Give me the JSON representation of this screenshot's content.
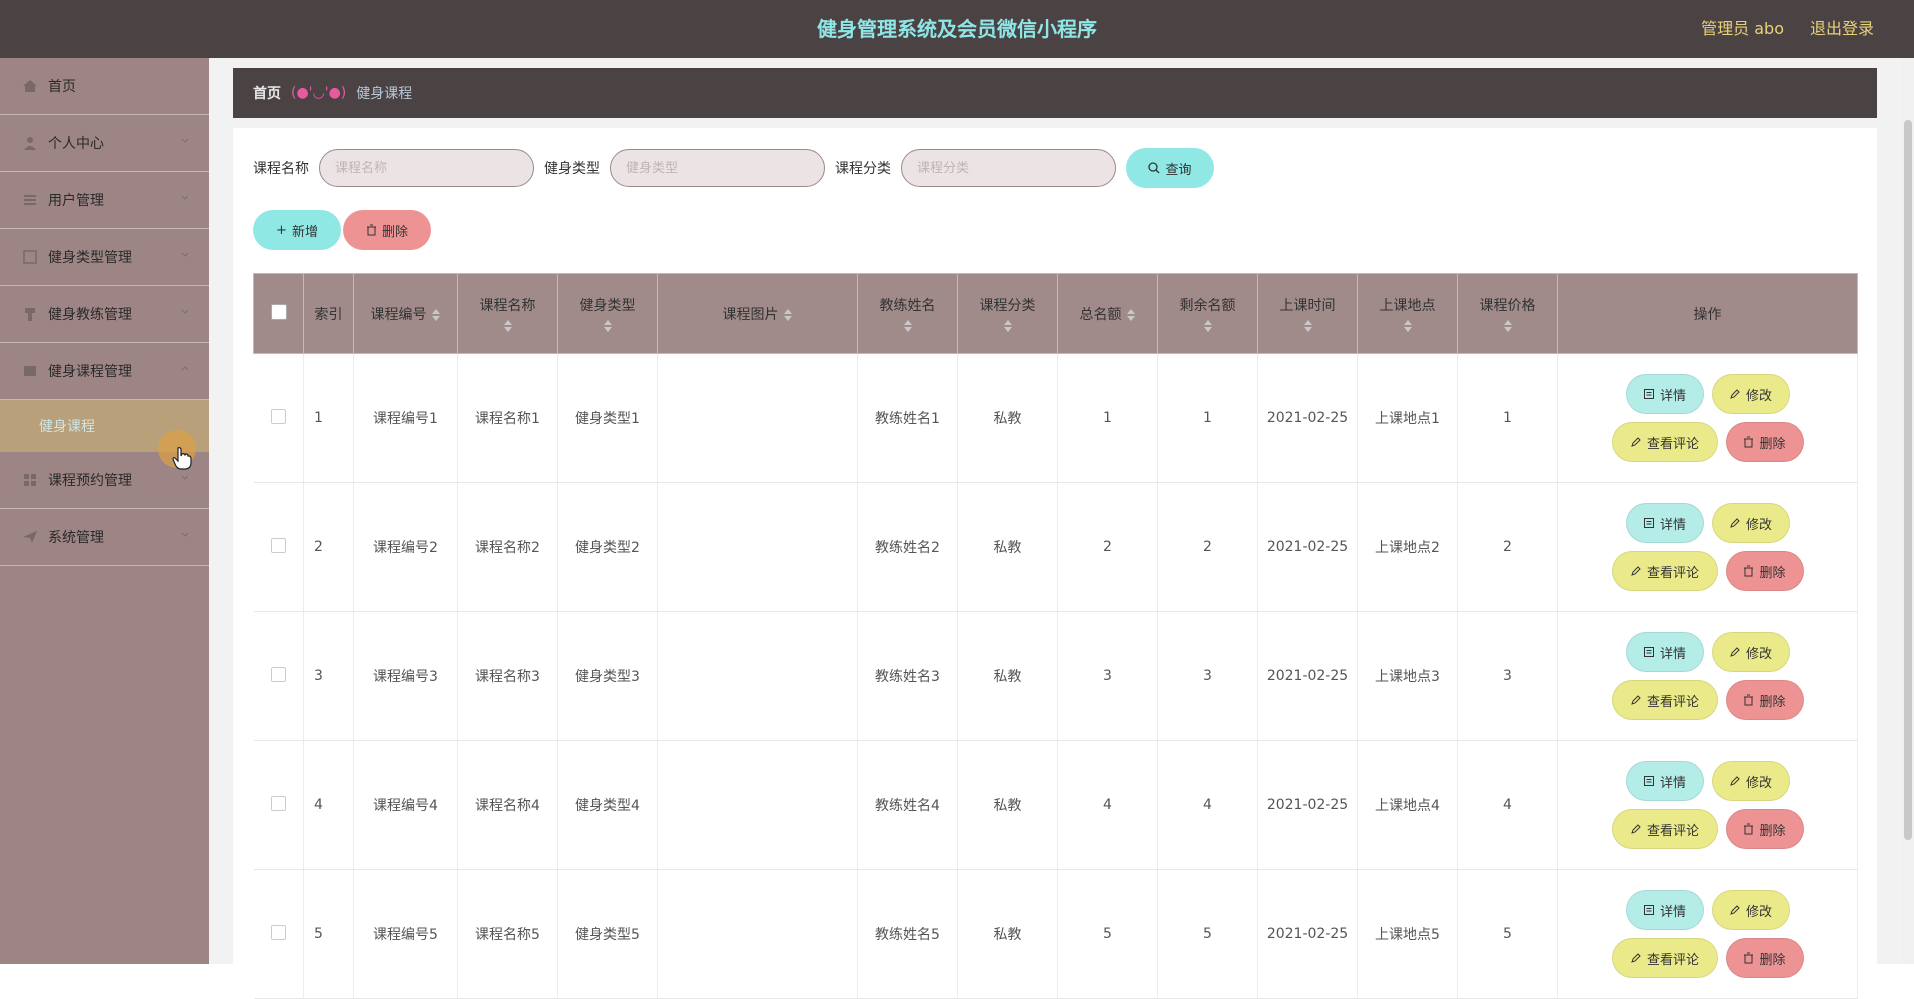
{
  "header": {
    "title": "健身管理系统及会员微信小程序",
    "admin": "管理员 abo",
    "logout": "退出登录"
  },
  "sidebar": {
    "items": [
      {
        "label": "首页",
        "icon": "home-icon"
      },
      {
        "label": "个人中心",
        "icon": "user-icon"
      },
      {
        "label": "用户管理",
        "icon": "list-icon"
      },
      {
        "label": "健身类型管理",
        "icon": "box-icon"
      },
      {
        "label": "健身教练管理",
        "icon": "coach-icon"
      },
      {
        "label": "健身课程管理",
        "icon": "course-icon"
      },
      {
        "label": "课程预约管理",
        "icon": "grid-icon"
      },
      {
        "label": "系统管理",
        "icon": "send-icon"
      }
    ],
    "active_sub": "健身课程"
  },
  "breadcrumb": {
    "home": "首页",
    "face": "(●'◡'●)",
    "current": "健身课程"
  },
  "search": {
    "course_name_label": "课程名称",
    "course_name_placeholder": "课程名称",
    "type_label": "健身类型",
    "type_placeholder": "健身类型",
    "category_label": "课程分类",
    "category_placeholder": "课程分类",
    "query_button": "查询"
  },
  "actions": {
    "add": "新增",
    "delete": "删除"
  },
  "table": {
    "headers": [
      "索引",
      "课程编号",
      "课程名称",
      "健身类型",
      "课程图片",
      "教练姓名",
      "课程分类",
      "总名额",
      "剩余名额",
      "上课时间",
      "上课地点",
      "课程价格",
      "操作"
    ],
    "rows": [
      {
        "index": "1",
        "code": "课程编号1",
        "name": "课程名称1",
        "type": "健身类型1",
        "coach": "教练姓名1",
        "category": "私教",
        "total": "1",
        "remaining": "1",
        "time": "2021-02-25",
        "place": "上课地点1",
        "price": "1"
      },
      {
        "index": "2",
        "code": "课程编号2",
        "name": "课程名称2",
        "type": "健身类型2",
        "coach": "教练姓名2",
        "category": "私教",
        "total": "2",
        "remaining": "2",
        "time": "2021-02-25",
        "place": "上课地点2",
        "price": "2"
      },
      {
        "index": "3",
        "code": "课程编号3",
        "name": "课程名称3",
        "type": "健身类型3",
        "coach": "教练姓名3",
        "category": "私教",
        "total": "3",
        "remaining": "3",
        "time": "2021-02-25",
        "place": "上课地点3",
        "price": "3"
      },
      {
        "index": "4",
        "code": "课程编号4",
        "name": "课程名称4",
        "type": "健身类型4",
        "coach": "教练姓名4",
        "category": "私教",
        "total": "4",
        "remaining": "4",
        "time": "2021-02-25",
        "place": "上课地点4",
        "price": "4"
      },
      {
        "index": "5",
        "code": "课程编号5",
        "name": "课程名称5",
        "type": "健身类型5",
        "coach": "教练姓名5",
        "category": "私教",
        "total": "5",
        "remaining": "5",
        "time": "2021-02-25",
        "place": "上课地点5",
        "price": "5"
      }
    ],
    "row_actions": {
      "detail": "详情",
      "edit": "修改",
      "review": "查看评论",
      "delete": "删除"
    }
  }
}
